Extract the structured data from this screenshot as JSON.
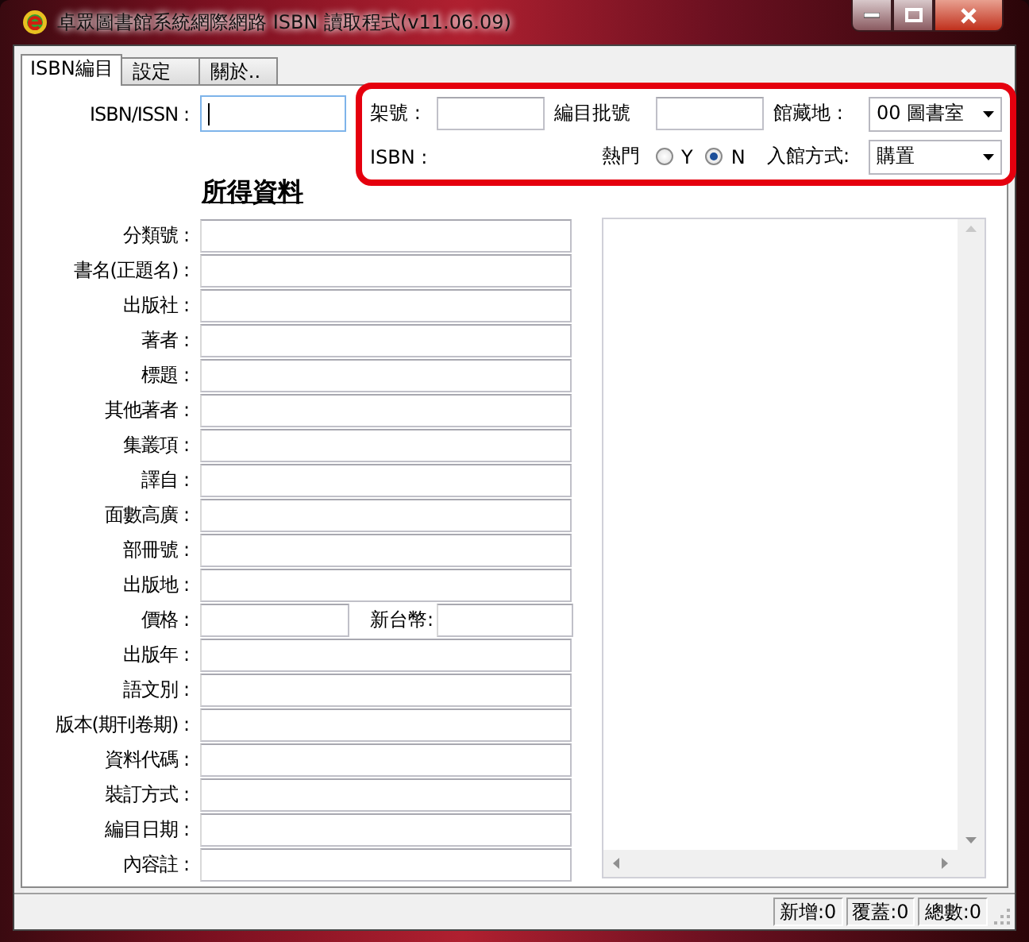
{
  "window": {
    "title": "卓眾圖書館系統網際網路 ISBN 讀取程式(v11.06.09)"
  },
  "tabs": [
    {
      "label": "ISBN編目",
      "selected": true
    },
    {
      "label": "設定",
      "selected": false
    },
    {
      "label": "關於..",
      "selected": false
    }
  ],
  "isbn_field": {
    "label": "ISBN/ISSN :"
  },
  "header": {
    "shelf_label": "架號 :",
    "batch_label": "編目批號",
    "location": {
      "label": "館藏地 :",
      "value": "00 圖書室"
    },
    "isbn_label": "ISBN :",
    "hot": {
      "label": "熱門",
      "options": [
        {
          "label": "Y",
          "selected": false
        },
        {
          "label": "N",
          "selected": true
        }
      ]
    },
    "acquisition": {
      "label": "入館方式:",
      "value": "購置"
    }
  },
  "section_title": "所得資料",
  "fields": [
    {
      "kind": "text",
      "label": "分類號 :"
    },
    {
      "kind": "text",
      "label": "書名(正題名) :"
    },
    {
      "kind": "text",
      "label": "出版社 :"
    },
    {
      "kind": "text",
      "label": "著者 :"
    },
    {
      "kind": "text",
      "label": "標題 :"
    },
    {
      "kind": "text",
      "label": "其他著者 :"
    },
    {
      "kind": "text",
      "label": "集叢項 :"
    },
    {
      "kind": "text",
      "label": "譯自 :"
    },
    {
      "kind": "text",
      "label": "面數高廣 :"
    },
    {
      "kind": "text",
      "label": "部冊號 :"
    },
    {
      "kind": "text",
      "label": "出版地 :"
    },
    {
      "kind": "price",
      "label": "價格 :",
      "currency_label": "新台幣:"
    },
    {
      "kind": "text",
      "label": "出版年 :"
    },
    {
      "kind": "text",
      "label": "語文別 :"
    },
    {
      "kind": "text",
      "label": "版本(期刊卷期) :"
    },
    {
      "kind": "text",
      "label": "資料代碼 :"
    },
    {
      "kind": "text",
      "label": "裝訂方式 :"
    },
    {
      "kind": "text",
      "label": "編目日期 :"
    },
    {
      "kind": "text",
      "label": "內容註 :"
    }
  ],
  "status_bar": [
    "新增:0",
    "覆蓋:0",
    "總數:0"
  ]
}
